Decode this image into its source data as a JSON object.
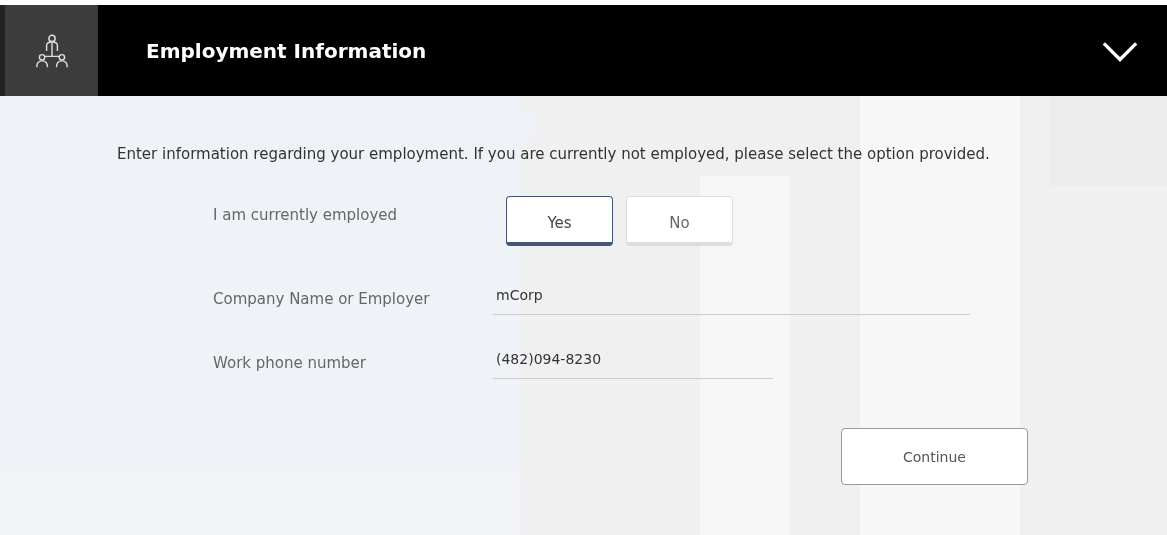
{
  "header": {
    "title": "Employment Information",
    "expanded": true
  },
  "intro": "Enter information regarding your employment. If you are currently not employed, please select the option provided.",
  "employed": {
    "label": "I am currently employed",
    "options": [
      {
        "label": "Yes",
        "selected": true
      },
      {
        "label": "No",
        "selected": false
      }
    ]
  },
  "fields": [
    {
      "label": "Company Name or Employer",
      "value": "mCorp"
    },
    {
      "label": "Work phone number",
      "value": "(482)094-8230"
    }
  ],
  "continue_button": "Continue"
}
